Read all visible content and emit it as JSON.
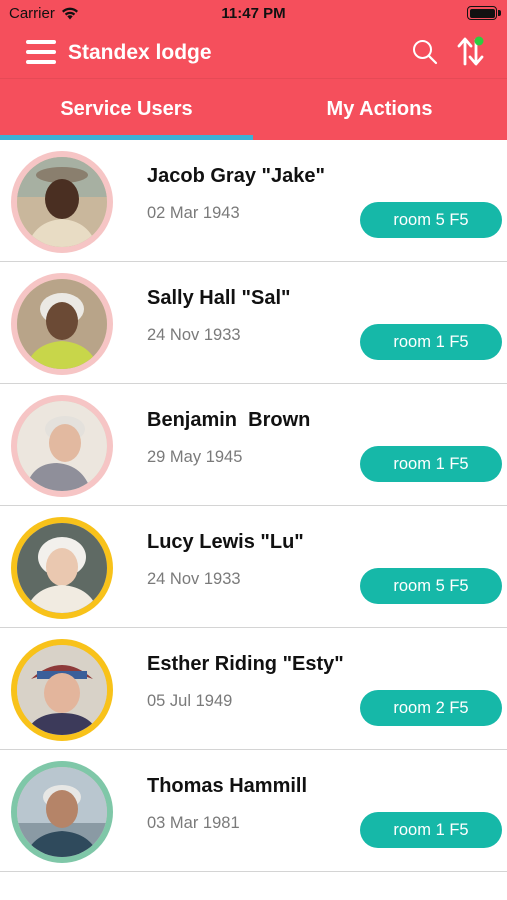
{
  "status_bar": {
    "carrier": "Carrier",
    "time": "11:47 PM"
  },
  "header": {
    "title": "Standex lodge",
    "icons": [
      "menu-icon",
      "search-icon",
      "sort-icon"
    ]
  },
  "tabs": [
    {
      "label": "Service Users",
      "selected": true
    },
    {
      "label": "My Actions",
      "selected": false
    }
  ],
  "colors": {
    "brand": "#F54F5C",
    "accent_tab": "#3DB0D6",
    "room_badge": "#16B8A8",
    "ring_pink": "#F6C5C5",
    "ring_yellow": "#F8C21A",
    "ring_green": "#7FC7A8"
  },
  "users": [
    {
      "name": "Jacob Gray \"Jake\"",
      "dob": "02 Mar 1943",
      "room": "room 5 F5",
      "ring": "#F6C5C5"
    },
    {
      "name": "Sally Hall \"Sal\"",
      "dob": "24 Nov 1933",
      "room": "room 1 F5",
      "ring": "#F6C5C5"
    },
    {
      "name": "Benjamin  Brown",
      "dob": "29 May 1945",
      "room": "room 1 F5",
      "ring": "#F6C5C5"
    },
    {
      "name": "Lucy Lewis \"Lu\"",
      "dob": "24 Nov 1933",
      "room": "room 5 F5",
      "ring": "#F8C21A"
    },
    {
      "name": "Esther Riding \"Esty\"",
      "dob": "05 Jul 1949",
      "room": "room 2 F5",
      "ring": "#F8C21A"
    },
    {
      "name": "Thomas Hammill",
      "dob": "03 Mar 1981",
      "room": "room 1 F5",
      "ring": "#7FC7A8"
    }
  ]
}
